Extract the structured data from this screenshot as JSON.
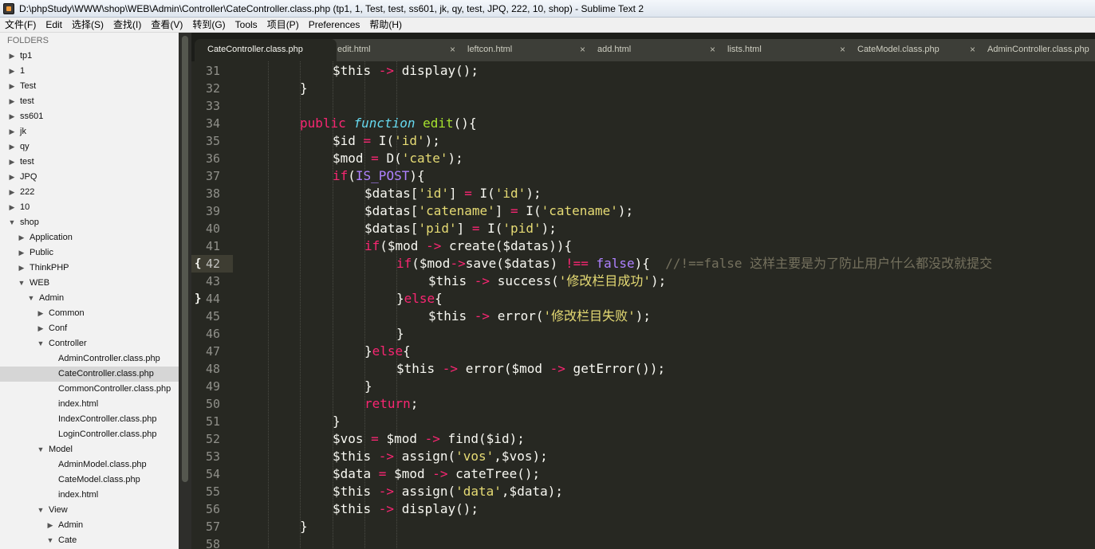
{
  "window": {
    "title": "D:\\phpStudy\\WWW\\shop\\WEB\\Admin\\Controller\\CateController.class.php (tp1, 1, Test, test, ss601, jk, qy, test, JPQ, 222, 10, shop) - Sublime Text 2"
  },
  "menu": [
    "文件(F)",
    "Edit",
    "选择(S)",
    "查找(I)",
    "查看(V)",
    "转到(G)",
    "Tools",
    "项目(P)",
    "Preferences",
    "帮助(H)"
  ],
  "sidebar": {
    "header": "FOLDERS",
    "items": [
      {
        "label": "tp1",
        "depth": 0,
        "arrow": "closed"
      },
      {
        "label": "1",
        "depth": 0,
        "arrow": "closed"
      },
      {
        "label": "Test",
        "depth": 0,
        "arrow": "closed"
      },
      {
        "label": "test",
        "depth": 0,
        "arrow": "closed"
      },
      {
        "label": "ss601",
        "depth": 0,
        "arrow": "closed"
      },
      {
        "label": "jk",
        "depth": 0,
        "arrow": "closed"
      },
      {
        "label": "qy",
        "depth": 0,
        "arrow": "closed"
      },
      {
        "label": "test",
        "depth": 0,
        "arrow": "closed"
      },
      {
        "label": "JPQ",
        "depth": 0,
        "arrow": "closed"
      },
      {
        "label": "222",
        "depth": 0,
        "arrow": "closed"
      },
      {
        "label": "10",
        "depth": 0,
        "arrow": "closed"
      },
      {
        "label": "shop",
        "depth": 0,
        "arrow": "open"
      },
      {
        "label": "Application",
        "depth": 1,
        "arrow": "closed"
      },
      {
        "label": "Public",
        "depth": 1,
        "arrow": "closed"
      },
      {
        "label": "ThinkPHP",
        "depth": 1,
        "arrow": "closed"
      },
      {
        "label": "WEB",
        "depth": 1,
        "arrow": "open"
      },
      {
        "label": "Admin",
        "depth": 2,
        "arrow": "open"
      },
      {
        "label": "Common",
        "depth": 3,
        "arrow": "closed"
      },
      {
        "label": "Conf",
        "depth": 3,
        "arrow": "closed"
      },
      {
        "label": "Controller",
        "depth": 3,
        "arrow": "open"
      },
      {
        "label": "AdminController.class.php",
        "depth": 4,
        "arrow": "none"
      },
      {
        "label": "CateController.class.php",
        "depth": 4,
        "arrow": "none",
        "selected": true
      },
      {
        "label": "CommonController.class.php",
        "depth": 4,
        "arrow": "none"
      },
      {
        "label": "index.html",
        "depth": 4,
        "arrow": "none"
      },
      {
        "label": "IndexController.class.php",
        "depth": 4,
        "arrow": "none"
      },
      {
        "label": "LoginController.class.php",
        "depth": 4,
        "arrow": "none"
      },
      {
        "label": "Model",
        "depth": 3,
        "arrow": "open"
      },
      {
        "label": "AdminModel.class.php",
        "depth": 4,
        "arrow": "none"
      },
      {
        "label": "CateModel.class.php",
        "depth": 4,
        "arrow": "none"
      },
      {
        "label": "index.html",
        "depth": 4,
        "arrow": "none"
      },
      {
        "label": "View",
        "depth": 3,
        "arrow": "open"
      },
      {
        "label": "Admin",
        "depth": 4,
        "arrow": "closed"
      },
      {
        "label": "Cate",
        "depth": 4,
        "arrow": "open"
      }
    ]
  },
  "tabs": [
    {
      "label": "CateController.class.php",
      "active": true
    },
    {
      "label": "edit.html",
      "close": "×"
    },
    {
      "label": "leftcon.html",
      "close": "×"
    },
    {
      "label": "add.html",
      "close": "×"
    },
    {
      "label": "lists.html",
      "close": "×"
    },
    {
      "label": "CateModel.class.php",
      "close": "×"
    },
    {
      "label": "AdminController.class.php"
    }
  ],
  "editor": {
    "current_line": 42,
    "fold_marks": [
      {
        "line": 42,
        "char": "{"
      },
      {
        "line": 44,
        "char": "}"
      }
    ],
    "lines": [
      {
        "n": 31,
        "indent": 3,
        "tokens": [
          [
            "v",
            "$this "
          ],
          [
            "kw",
            "->"
          ],
          [
            "v",
            " display();"
          ]
        ]
      },
      {
        "n": 32,
        "indent": 2,
        "tokens": [
          [
            "v",
            "}"
          ]
        ]
      },
      {
        "n": 33,
        "indent": 0,
        "tokens": []
      },
      {
        "n": 34,
        "indent": 2,
        "tokens": [
          [
            "kw",
            "public"
          ],
          [
            "v",
            " "
          ],
          [
            "df",
            "function"
          ],
          [
            "v",
            " "
          ],
          [
            "fn",
            "edit"
          ],
          [
            "v",
            "(){"
          ]
        ]
      },
      {
        "n": 35,
        "indent": 3,
        "tokens": [
          [
            "v",
            "$id "
          ],
          [
            "kw",
            "="
          ],
          [
            "v",
            " I("
          ],
          [
            "st",
            "'id'"
          ],
          [
            "v",
            ");"
          ]
        ]
      },
      {
        "n": 36,
        "indent": 3,
        "tokens": [
          [
            "v",
            "$mod "
          ],
          [
            "kw",
            "="
          ],
          [
            "v",
            " D("
          ],
          [
            "st",
            "'cate'"
          ],
          [
            "v",
            ");"
          ]
        ]
      },
      {
        "n": 37,
        "indent": 3,
        "tokens": [
          [
            "kw",
            "if"
          ],
          [
            "v",
            "("
          ],
          [
            "cn",
            "IS_POST"
          ],
          [
            "v",
            "){"
          ]
        ]
      },
      {
        "n": 38,
        "indent": 4,
        "tokens": [
          [
            "v",
            "$datas["
          ],
          [
            "st",
            "'id'"
          ],
          [
            "v",
            "] "
          ],
          [
            "kw",
            "="
          ],
          [
            "v",
            " I("
          ],
          [
            "st",
            "'id'"
          ],
          [
            "v",
            ");"
          ]
        ]
      },
      {
        "n": 39,
        "indent": 4,
        "tokens": [
          [
            "v",
            "$datas["
          ],
          [
            "st",
            "'catename'"
          ],
          [
            "v",
            "] "
          ],
          [
            "kw",
            "="
          ],
          [
            "v",
            " I("
          ],
          [
            "st",
            "'catename'"
          ],
          [
            "v",
            ");"
          ]
        ]
      },
      {
        "n": 40,
        "indent": 4,
        "tokens": [
          [
            "v",
            "$datas["
          ],
          [
            "st",
            "'pid'"
          ],
          [
            "v",
            "] "
          ],
          [
            "kw",
            "="
          ],
          [
            "v",
            " I("
          ],
          [
            "st",
            "'pid'"
          ],
          [
            "v",
            ");"
          ]
        ]
      },
      {
        "n": 41,
        "indent": 4,
        "tokens": [
          [
            "kw",
            "if"
          ],
          [
            "v",
            "($mod "
          ],
          [
            "kw",
            "->"
          ],
          [
            "v",
            " create($datas)){"
          ]
        ]
      },
      {
        "n": 42,
        "indent": 5,
        "tokens": [
          [
            "kw",
            "if"
          ],
          [
            "v",
            "($mod"
          ],
          [
            "kw",
            "->"
          ],
          [
            "v",
            "save($datas) "
          ],
          [
            "kw",
            "!=="
          ],
          [
            "v",
            " "
          ],
          [
            "cn",
            "false"
          ],
          [
            "v",
            "){  "
          ],
          [
            "cm",
            "//!==false 这样主要是为了防止用户什么都没改就提交"
          ]
        ]
      },
      {
        "n": 43,
        "indent": 6,
        "tokens": [
          [
            "v",
            "$this "
          ],
          [
            "kw",
            "->"
          ],
          [
            "v",
            " success("
          ],
          [
            "st",
            "'修改栏目成功'"
          ],
          [
            "v",
            ");"
          ]
        ]
      },
      {
        "n": 44,
        "indent": 5,
        "tokens": [
          [
            "v",
            "}"
          ],
          [
            "kw",
            "else"
          ],
          [
            "v",
            "{"
          ]
        ]
      },
      {
        "n": 45,
        "indent": 6,
        "tokens": [
          [
            "v",
            "$this "
          ],
          [
            "kw",
            "->"
          ],
          [
            "v",
            " error("
          ],
          [
            "st",
            "'修改栏目失败'"
          ],
          [
            "v",
            ");"
          ]
        ]
      },
      {
        "n": 46,
        "indent": 5,
        "tokens": [
          [
            "v",
            "}"
          ]
        ]
      },
      {
        "n": 47,
        "indent": 4,
        "tokens": [
          [
            "v",
            "}"
          ],
          [
            "kw",
            "else"
          ],
          [
            "v",
            "{"
          ]
        ]
      },
      {
        "n": 48,
        "indent": 5,
        "tokens": [
          [
            "v",
            "$this "
          ],
          [
            "kw",
            "->"
          ],
          [
            "v",
            " error($mod "
          ],
          [
            "kw",
            "->"
          ],
          [
            "v",
            " getError());"
          ]
        ]
      },
      {
        "n": 49,
        "indent": 4,
        "tokens": [
          [
            "v",
            "}"
          ]
        ]
      },
      {
        "n": 50,
        "indent": 4,
        "tokens": [
          [
            "kw",
            "return"
          ],
          [
            "v",
            ";"
          ]
        ]
      },
      {
        "n": 51,
        "indent": 3,
        "tokens": [
          [
            "v",
            "}"
          ]
        ]
      },
      {
        "n": 52,
        "indent": 3,
        "tokens": [
          [
            "v",
            "$vos "
          ],
          [
            "kw",
            "="
          ],
          [
            "v",
            " $mod "
          ],
          [
            "kw",
            "->"
          ],
          [
            "v",
            " find($id);"
          ]
        ]
      },
      {
        "n": 53,
        "indent": 3,
        "tokens": [
          [
            "v",
            "$this "
          ],
          [
            "kw",
            "->"
          ],
          [
            "v",
            " assign("
          ],
          [
            "st",
            "'vos'"
          ],
          [
            "v",
            ",$vos);"
          ]
        ]
      },
      {
        "n": 54,
        "indent": 3,
        "tokens": [
          [
            "v",
            "$data "
          ],
          [
            "kw",
            "="
          ],
          [
            "v",
            " $mod "
          ],
          [
            "kw",
            "->"
          ],
          [
            "v",
            " cateTree();"
          ]
        ]
      },
      {
        "n": 55,
        "indent": 3,
        "tokens": [
          [
            "v",
            "$this "
          ],
          [
            "kw",
            "->"
          ],
          [
            "v",
            " assign("
          ],
          [
            "st",
            "'data'"
          ],
          [
            "v",
            ",$data);"
          ]
        ]
      },
      {
        "n": 56,
        "indent": 3,
        "tokens": [
          [
            "v",
            "$this "
          ],
          [
            "kw",
            "->"
          ],
          [
            "v",
            " display();"
          ]
        ]
      },
      {
        "n": 57,
        "indent": 2,
        "tokens": [
          [
            "v",
            "}"
          ]
        ]
      },
      {
        "n": 58,
        "indent": 0,
        "tokens": []
      }
    ]
  },
  "colors": {
    "background": "#272822",
    "keyword": "#f92672",
    "string": "#e6db74",
    "function": "#a6e22e",
    "storage": "#66d9ef",
    "constant": "#ae81ff",
    "comment": "#75715e"
  }
}
